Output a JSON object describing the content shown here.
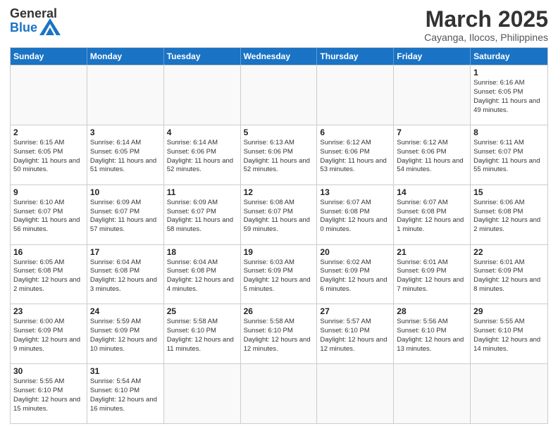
{
  "header": {
    "logo_general": "General",
    "logo_blue": "Blue",
    "month_year": "March 2025",
    "location": "Cayanga, Ilocos, Philippines"
  },
  "days_of_week": [
    "Sunday",
    "Monday",
    "Tuesday",
    "Wednesday",
    "Thursday",
    "Friday",
    "Saturday"
  ],
  "weeks": [
    [
      {
        "day": "",
        "info": ""
      },
      {
        "day": "",
        "info": ""
      },
      {
        "day": "",
        "info": ""
      },
      {
        "day": "",
        "info": ""
      },
      {
        "day": "",
        "info": ""
      },
      {
        "day": "",
        "info": ""
      },
      {
        "day": "1",
        "info": "Sunrise: 6:16 AM\nSunset: 6:05 PM\nDaylight: 11 hours\nand 49 minutes."
      }
    ],
    [
      {
        "day": "2",
        "info": "Sunrise: 6:15 AM\nSunset: 6:05 PM\nDaylight: 11 hours\nand 50 minutes."
      },
      {
        "day": "3",
        "info": "Sunrise: 6:14 AM\nSunset: 6:05 PM\nDaylight: 11 hours\nand 51 minutes."
      },
      {
        "day": "4",
        "info": "Sunrise: 6:14 AM\nSunset: 6:06 PM\nDaylight: 11 hours\nand 52 minutes."
      },
      {
        "day": "5",
        "info": "Sunrise: 6:13 AM\nSunset: 6:06 PM\nDaylight: 11 hours\nand 52 minutes."
      },
      {
        "day": "6",
        "info": "Sunrise: 6:12 AM\nSunset: 6:06 PM\nDaylight: 11 hours\nand 53 minutes."
      },
      {
        "day": "7",
        "info": "Sunrise: 6:12 AM\nSunset: 6:06 PM\nDaylight: 11 hours\nand 54 minutes."
      },
      {
        "day": "8",
        "info": "Sunrise: 6:11 AM\nSunset: 6:07 PM\nDaylight: 11 hours\nand 55 minutes."
      }
    ],
    [
      {
        "day": "9",
        "info": "Sunrise: 6:10 AM\nSunset: 6:07 PM\nDaylight: 11 hours\nand 56 minutes."
      },
      {
        "day": "10",
        "info": "Sunrise: 6:09 AM\nSunset: 6:07 PM\nDaylight: 11 hours\nand 57 minutes."
      },
      {
        "day": "11",
        "info": "Sunrise: 6:09 AM\nSunset: 6:07 PM\nDaylight: 11 hours\nand 58 minutes."
      },
      {
        "day": "12",
        "info": "Sunrise: 6:08 AM\nSunset: 6:07 PM\nDaylight: 11 hours\nand 59 minutes."
      },
      {
        "day": "13",
        "info": "Sunrise: 6:07 AM\nSunset: 6:08 PM\nDaylight: 12 hours\nand 0 minutes."
      },
      {
        "day": "14",
        "info": "Sunrise: 6:07 AM\nSunset: 6:08 PM\nDaylight: 12 hours\nand 1 minute."
      },
      {
        "day": "15",
        "info": "Sunrise: 6:06 AM\nSunset: 6:08 PM\nDaylight: 12 hours\nand 2 minutes."
      }
    ],
    [
      {
        "day": "16",
        "info": "Sunrise: 6:05 AM\nSunset: 6:08 PM\nDaylight: 12 hours\nand 2 minutes."
      },
      {
        "day": "17",
        "info": "Sunrise: 6:04 AM\nSunset: 6:08 PM\nDaylight: 12 hours\nand 3 minutes."
      },
      {
        "day": "18",
        "info": "Sunrise: 6:04 AM\nSunset: 6:08 PM\nDaylight: 12 hours\nand 4 minutes."
      },
      {
        "day": "19",
        "info": "Sunrise: 6:03 AM\nSunset: 6:09 PM\nDaylight: 12 hours\nand 5 minutes."
      },
      {
        "day": "20",
        "info": "Sunrise: 6:02 AM\nSunset: 6:09 PM\nDaylight: 12 hours\nand 6 minutes."
      },
      {
        "day": "21",
        "info": "Sunrise: 6:01 AM\nSunset: 6:09 PM\nDaylight: 12 hours\nand 7 minutes."
      },
      {
        "day": "22",
        "info": "Sunrise: 6:01 AM\nSunset: 6:09 PM\nDaylight: 12 hours\nand 8 minutes."
      }
    ],
    [
      {
        "day": "23",
        "info": "Sunrise: 6:00 AM\nSunset: 6:09 PM\nDaylight: 12 hours\nand 9 minutes."
      },
      {
        "day": "24",
        "info": "Sunrise: 5:59 AM\nSunset: 6:09 PM\nDaylight: 12 hours\nand 10 minutes."
      },
      {
        "day": "25",
        "info": "Sunrise: 5:58 AM\nSunset: 6:10 PM\nDaylight: 12 hours\nand 11 minutes."
      },
      {
        "day": "26",
        "info": "Sunrise: 5:58 AM\nSunset: 6:10 PM\nDaylight: 12 hours\nand 12 minutes."
      },
      {
        "day": "27",
        "info": "Sunrise: 5:57 AM\nSunset: 6:10 PM\nDaylight: 12 hours\nand 12 minutes."
      },
      {
        "day": "28",
        "info": "Sunrise: 5:56 AM\nSunset: 6:10 PM\nDaylight: 12 hours\nand 13 minutes."
      },
      {
        "day": "29",
        "info": "Sunrise: 5:55 AM\nSunset: 6:10 PM\nDaylight: 12 hours\nand 14 minutes."
      }
    ],
    [
      {
        "day": "30",
        "info": "Sunrise: 5:55 AM\nSunset: 6:10 PM\nDaylight: 12 hours\nand 15 minutes."
      },
      {
        "day": "31",
        "info": "Sunrise: 5:54 AM\nSunset: 6:10 PM\nDaylight: 12 hours\nand 16 minutes."
      },
      {
        "day": "",
        "info": ""
      },
      {
        "day": "",
        "info": ""
      },
      {
        "day": "",
        "info": ""
      },
      {
        "day": "",
        "info": ""
      },
      {
        "day": "",
        "info": ""
      }
    ]
  ]
}
